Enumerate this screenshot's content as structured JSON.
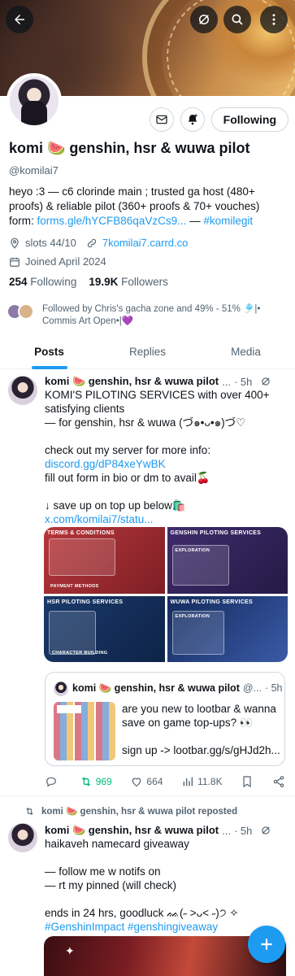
{
  "header": {
    "back_icon": "arrow-left-icon",
    "grok_icon": "grok-icon",
    "search_icon": "search-icon",
    "more_icon": "more-vertical-icon"
  },
  "profile": {
    "display_name": "komi 🍉 genshin, hsr & wuwa pilot",
    "handle": "@komilai7",
    "follow_label": "Following",
    "bio_text": "heyo :3 — c6 clorinde main ; trusted ga host (480+ proofs) & reliable pilot (360+ proofs & 70+ vouches) form: ",
    "bio_link": "forms.gle/hYCFB86qaVzCs9...",
    "bio_sep": " — ",
    "bio_hashtag": "#komilegit",
    "slots": "slots 44/10",
    "website": "7komilai7.carrd.co",
    "joined": "Joined April 2024",
    "following_count": "254",
    "following_label": "Following",
    "followers_count": "19.9K",
    "followers_label": "Followers",
    "followed_by": "Followed by Chris's gacha zone and 49% - 51% 🎐|• Commis Art Open•|💜"
  },
  "tabs": [
    "Posts",
    "Replies",
    "Media"
  ],
  "post1": {
    "name": "komi 🍉 genshin, hsr & wuwa pilot",
    "dots": "...",
    "time": "· 5h",
    "text_main": "KOMI'S PILOTING SERVICES with over 400+ satisfying clients\n— for genshin, hsr & wuwa (づ๑•ᴗ•๑)づ♡\n\ncheck out my server for more info: ",
    "discord_link": "discord.gg/dP84xeYwBK",
    "text_mid": "\nfill out form in bio or dm to avail🍒\n\n↓ save up on top up below🛍️\n",
    "x_link": "x.com/komilai7/statu...",
    "media": [
      {
        "title": "TERMS & CONDITIONS",
        "sub": "PAYMENT METHODS"
      },
      {
        "title": "GENSHIN PILOTING SERVICES",
        "sub": "EXPLORATION"
      },
      {
        "title": "HSR PILOTING SERVICES",
        "sub": "CHARACTER BUILDING"
      },
      {
        "title": "WUWA PILOTING SERVICES",
        "sub": "EXPLORATION"
      }
    ],
    "quote": {
      "name": "komi 🍉 genshin, hsr & wuwa pilot",
      "handle": "@...",
      "time": "· 5h",
      "text": "are you new to lootbar & wanna save on game top-ups? 👀\n\nsign up -> lootbar.gg/s/gHJd2h..."
    },
    "reply_count": "",
    "retweet_count": "969",
    "like_count": "664",
    "views_count": "11.8K"
  },
  "post2": {
    "repost_label": "komi 🍉 genshin, hsr & wuwa pilot reposted",
    "name": "komi 🍉 genshin, hsr & wuwa pilot",
    "dots": "...",
    "time": "· 5h",
    "text": "haikaveh namecard giveaway\n\n— follow me w notifs on\n— rt my pinned (will check)\n\nends in 24 hrs, goodluck ᨐ(˶ ˃ᴗ˂ ˶)੭ ✧\n",
    "hashtags": "#GenshinImpact #genshingiveaway"
  },
  "colors": {
    "accent": "#1d9bf0",
    "retweet_green": "#00ba7c",
    "text": "#0f1419",
    "muted": "#536471"
  }
}
